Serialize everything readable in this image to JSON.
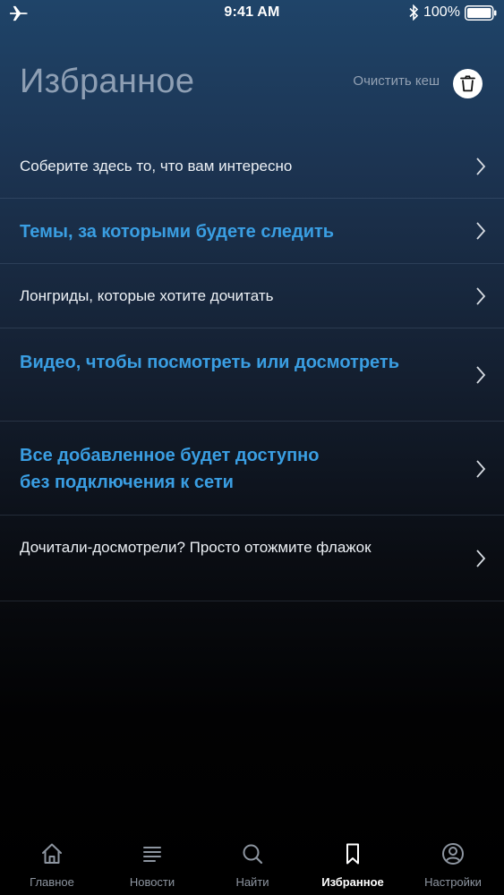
{
  "status_bar": {
    "time": "9:41 AM",
    "battery": "100%",
    "icons": [
      "airplane-icon",
      "bluetooth-icon",
      "battery-icon"
    ]
  },
  "header": {
    "title": "Избранное",
    "clear_cache_label": "Очистить кеш",
    "clear_cache_icon": "trash-icon"
  },
  "items": [
    {
      "text": "Соберите здесь то, что вам интересно",
      "style": "plain"
    },
    {
      "text": "Темы, за которыми будете следить",
      "style": "accent"
    },
    {
      "text": "Лонгриды, которые хотите дочитать",
      "style": "plain"
    },
    {
      "text": "Видео, чтобы посмотреть или досмотреть",
      "style": "accent"
    },
    {
      "text": "Все добавленное будет доступно\nбез подключения к сети",
      "style": "accent"
    },
    {
      "text": "Дочитали-досмотрели? Просто отожмите флажок",
      "style": "plain"
    }
  ],
  "tabs": [
    {
      "label": "Главное",
      "icon": "home-icon",
      "active": false
    },
    {
      "label": "Новости",
      "icon": "list-icon",
      "active": false
    },
    {
      "label": "Найти",
      "icon": "search-icon",
      "active": false
    },
    {
      "label": "Избранное",
      "icon": "bookmark-icon",
      "active": true
    },
    {
      "label": "Настройки",
      "icon": "profile-icon",
      "active": false
    }
  ],
  "colors": {
    "accent": "#3a9ee2",
    "title": "#8e9fb4",
    "tab_inactive": "#8d95a0",
    "tab_active": "#ffffff"
  }
}
